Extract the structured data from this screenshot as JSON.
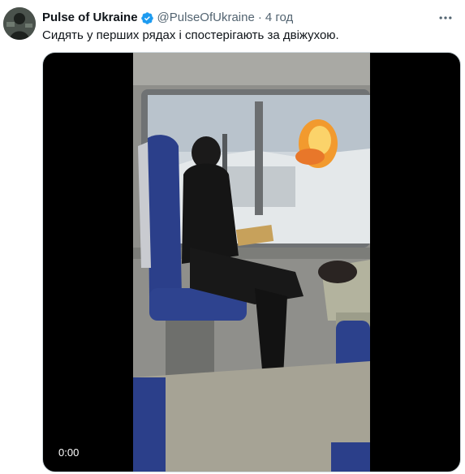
{
  "tweet": {
    "display_name": "Pulse of Ukraine",
    "handle": "@PulseOfUkraine",
    "separator": "·",
    "time": "4 год",
    "text": "Сидять у перших рядах і спостерігають за двіжухою.",
    "verified_icon": "verified-badge-icon",
    "more_icon": "more-icon"
  },
  "video": {
    "timestamp": "0:00"
  },
  "colors": {
    "text_primary": "#0f1419",
    "text_secondary": "#536471",
    "verified": "#1d9bf0",
    "media_bg": "#000000"
  }
}
